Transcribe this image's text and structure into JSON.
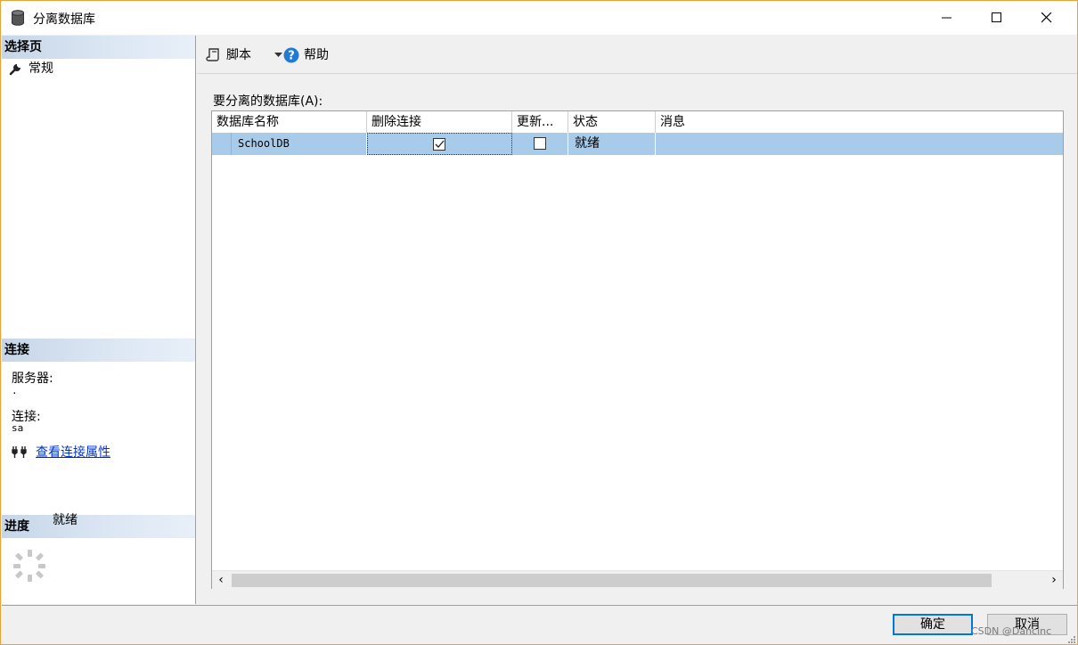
{
  "window": {
    "title": "分离数据库",
    "icon": "database-icon",
    "controls": [
      "minimize-icon",
      "maximize-icon",
      "close-icon"
    ],
    "border_color": "#e8a43a"
  },
  "sidebar": {
    "select_page": {
      "header": "选择页",
      "items": [
        {
          "label": "常规",
          "icon": "wrench-icon"
        }
      ]
    },
    "connection": {
      "header": "连接",
      "server_label": "服务器:",
      "server_value": ".",
      "connection_label": "连接:",
      "connection_value": "sa",
      "view_properties_link": "查看连接属性",
      "link_icon": "plug-icon"
    },
    "progress": {
      "header": "进度",
      "status": "就绪",
      "icon": "spinner-icon"
    }
  },
  "toolbar": {
    "script_label": "脚本",
    "script_icon": "script-icon",
    "help_label": "帮助",
    "help_icon": "help-icon"
  },
  "main": {
    "grid_label": "要分离的数据库(A):",
    "columns": [
      "数据库名称",
      "删除连接",
      "更新...",
      "状态",
      "消息"
    ],
    "rows": [
      {
        "name": "SchoolDB",
        "drop_connections": true,
        "update_statistics": false,
        "status": "就绪",
        "message": ""
      }
    ],
    "selection_color": "#a9cbea"
  },
  "buttons": {
    "ok": "确定",
    "cancel": "取消"
  },
  "watermark": "CSDN @Dancinc"
}
